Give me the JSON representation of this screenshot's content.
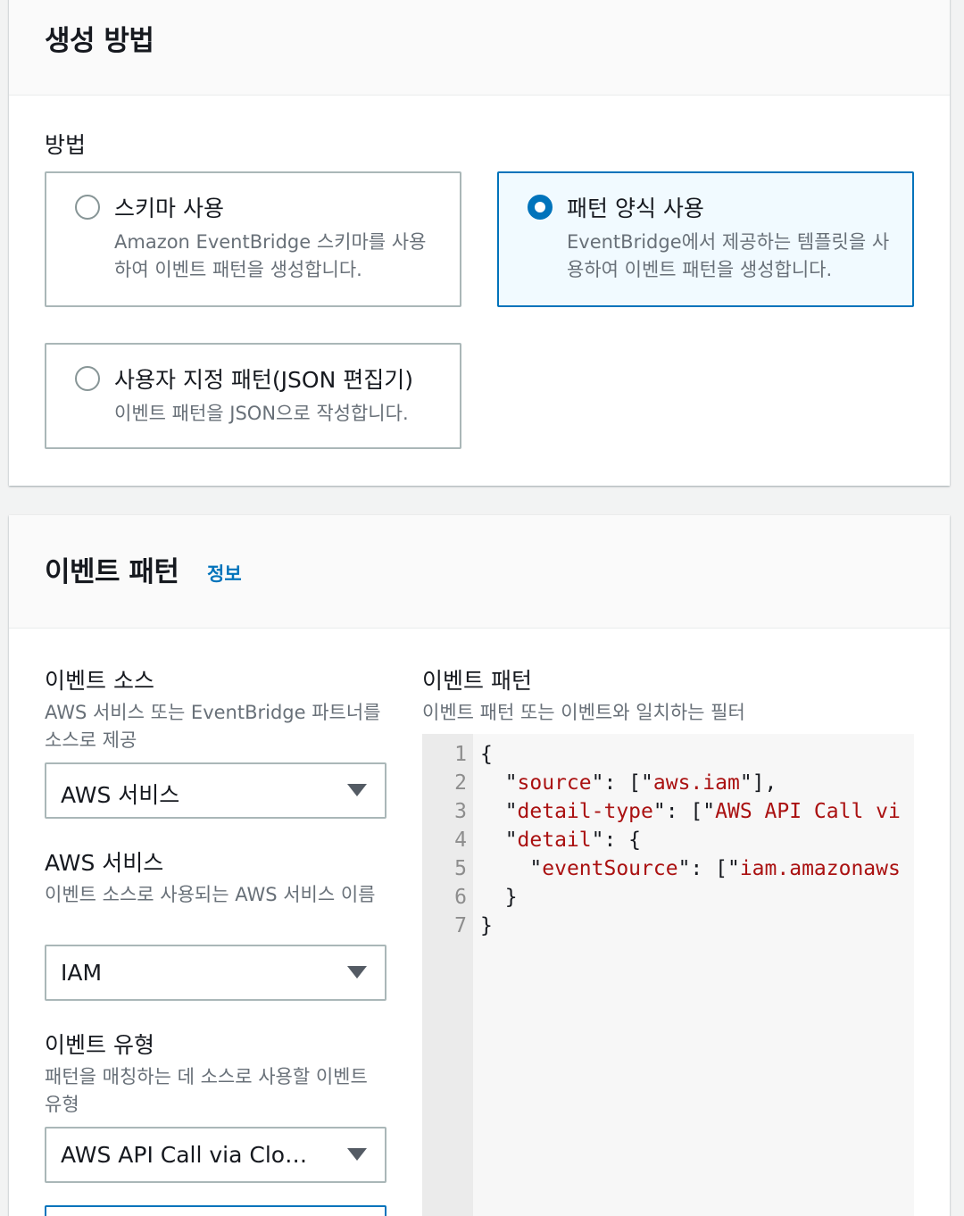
{
  "method_panel": {
    "title": "생성 방법",
    "label": "방법",
    "options": [
      {
        "title": "스키마 사용",
        "description": "Amazon EventBridge 스키마를 사용하여 이벤트 패턴을 생성합니다.",
        "selected": false
      },
      {
        "title": "패턴 양식 사용",
        "description": "EventBridge에서 제공하는 템플릿을 사용하여 이벤트 패턴을 생성합니다.",
        "selected": true
      },
      {
        "title": "사용자 지정 패턴(JSON 편집기)",
        "description": "이벤트 패턴을 JSON으로 작성합니다.",
        "selected": false
      }
    ]
  },
  "pattern_panel": {
    "title": "이벤트 패턴",
    "info_link": "정보",
    "event_source": {
      "label": "이벤트 소스",
      "description": "AWS 서비스 또는 EventBridge 파트너를 소스로 제공",
      "value": "AWS 서비스"
    },
    "aws_service": {
      "label": "AWS 서비스",
      "description": "이벤트 소스로 사용되는 AWS 서비스 이름",
      "value": "IAM"
    },
    "event_type": {
      "label": "이벤트 유형",
      "description": "패턴을 매칭하는 데 소스로 사용할 이벤트 유형",
      "value": "AWS API Call via Clo…"
    },
    "pattern_editor": {
      "label": "이벤트 패턴",
      "description": "이벤트 패턴 또는 이벤트와 일치하는 필터",
      "lines": [
        {
          "n": "1",
          "text": "{"
        },
        {
          "n": "2",
          "text": "  \"source\": [\"aws.iam\"],"
        },
        {
          "n": "3",
          "text": "  \"detail-type\": [\"AWS API Call vi"
        },
        {
          "n": "4",
          "text": "  \"detail\": {"
        },
        {
          "n": "5",
          "text": "    \"eventSource\": [\"iam.amazonaws"
        },
        {
          "n": "6",
          "text": "  }"
        },
        {
          "n": "7",
          "text": "}"
        }
      ]
    }
  }
}
